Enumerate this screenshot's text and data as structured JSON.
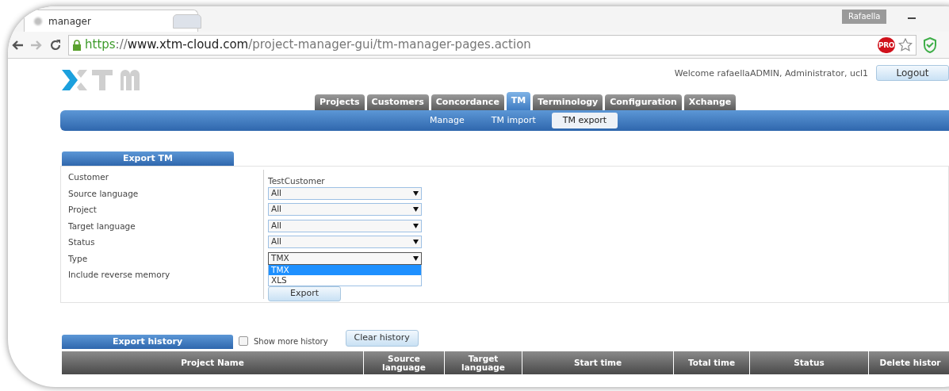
{
  "browser": {
    "tab_title": "manager",
    "user_badge": "Rafaella",
    "url": [
      {
        "kind": "scheme",
        "text": "https"
      },
      {
        "kind": "sep",
        "text": "://"
      },
      {
        "kind": "host",
        "text": "www.xtm-cloud.com"
      },
      {
        "kind": "path",
        "text": "/project-manager-gui/tm-manager-pages.action"
      }
    ],
    "extension_badge": "PRO"
  },
  "header": {
    "welcome": "Welcome rafaellaADMIN, Administrator, ucl1",
    "logout": "Logout"
  },
  "main_tabs": [
    {
      "label": "Projects",
      "selected": false
    },
    {
      "label": "Customers",
      "selected": false
    },
    {
      "label": "Concordance",
      "selected": false
    },
    {
      "label": "TM",
      "selected": true
    },
    {
      "label": "Terminology",
      "selected": false
    },
    {
      "label": "Configuration",
      "selected": false
    },
    {
      "label": "Xchange",
      "selected": false
    }
  ],
  "sub_tabs": [
    {
      "label": "Manage",
      "selected": false
    },
    {
      "label": "TM import",
      "selected": false
    },
    {
      "label": "TM export",
      "selected": true
    }
  ],
  "export_panel": {
    "title": "Export TM",
    "fields": [
      {
        "label": "Customer",
        "kind": "text",
        "value": "TestCustomer"
      },
      {
        "label": "Source language",
        "kind": "select",
        "value": "All"
      },
      {
        "label": "Project",
        "kind": "select",
        "value": "All"
      },
      {
        "label": "Target language",
        "kind": "select",
        "value": "All"
      },
      {
        "label": "Status",
        "kind": "select",
        "value": "All"
      },
      {
        "label": "Type",
        "kind": "select",
        "value": "TMX",
        "expanded": true,
        "options": [
          {
            "label": "TMX",
            "selected": true
          },
          {
            "label": "XLS",
            "selected": false
          }
        ]
      },
      {
        "label": "Include reverse memory",
        "kind": "label"
      }
    ],
    "export_button": "Export"
  },
  "history": {
    "title": "Export history",
    "show_more": {
      "label": "Show more history",
      "checked": false
    },
    "clear_button": "Clear history",
    "columns": [
      "Project Name",
      "Source language",
      "Target language",
      "Start time",
      "Total time",
      "Status",
      "Delete histor"
    ]
  }
}
